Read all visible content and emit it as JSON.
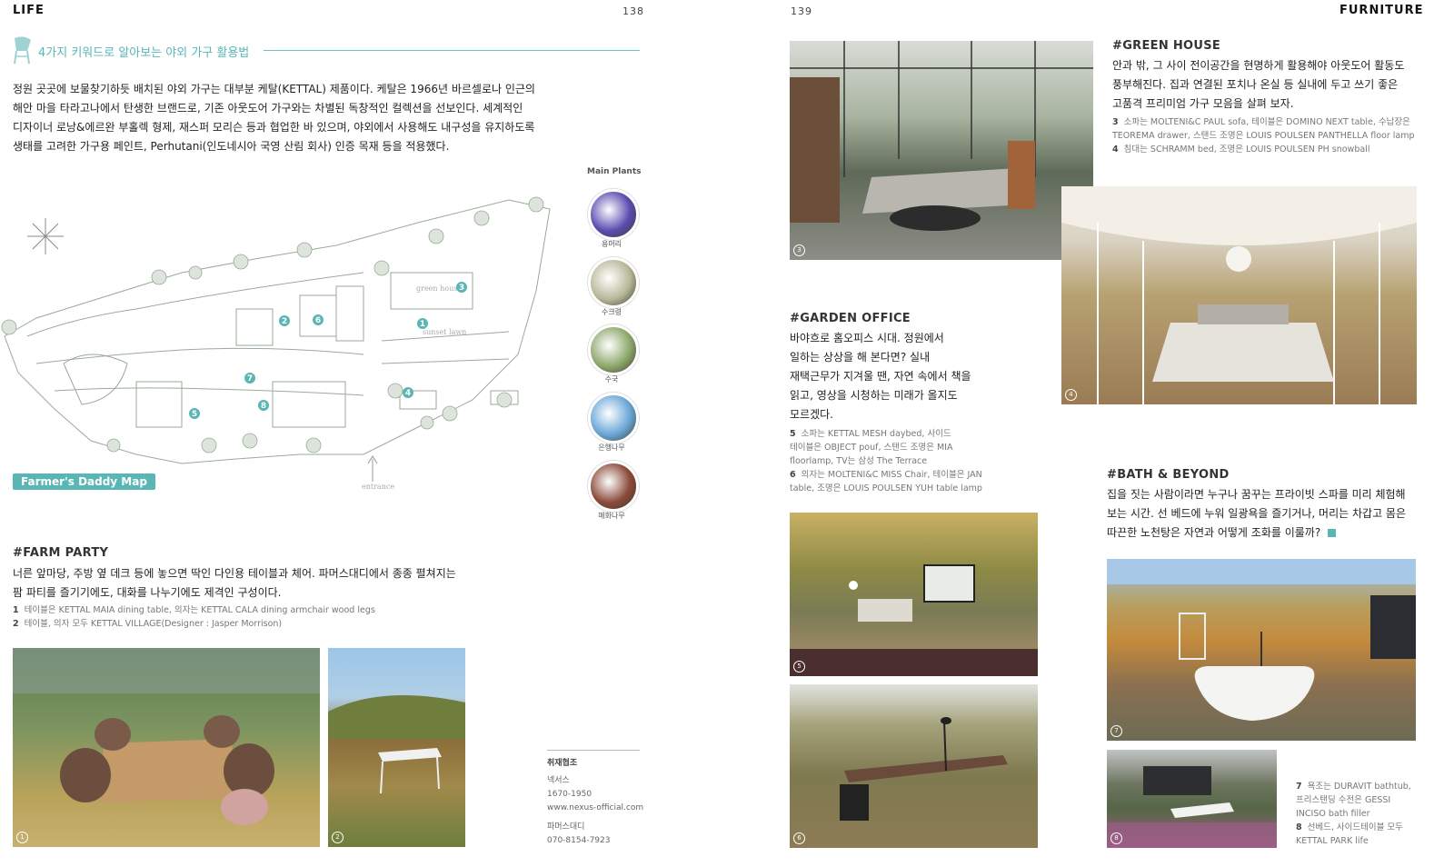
{
  "left_page": {
    "section": "LIFE",
    "page_number": "138",
    "heading": "4가지 키워드로 알아보는 야외 가구 활용법",
    "intro": [
      "정원 곳곳에 보물찾기하듯 배치된 야외 가구는 대부분 케탈(KETTAL) 제품이다. 케탈은 1966년 바르셀로나 인근의",
      "해안 마을 타라고나에서 탄생한 브랜드로, 기존 아웃도어 가구와는 차별된 독창적인 컬렉션을 선보인다. 세계적인",
      "디자이너 로낭&에르완 부홀렉 형제, 재스퍼 모리슨 등과 협업한 바 있으며, 야외에서 사용해도 내구성을 유지하도록",
      "생태를 고려한 가구용 페인트, Perhutani(인도네시아 국영 산림 회사) 인증 목재 등을 적용했다."
    ],
    "map_label": "Farmer's Daddy Map",
    "map_entrance": "entrance",
    "map_places": [
      "green house",
      "sunset lawn"
    ],
    "map_numbers": [
      "1",
      "2",
      "3",
      "4",
      "5",
      "6",
      "7",
      "8"
    ],
    "plants_title": "Main Plants",
    "plants": [
      {
        "name": "용머리",
        "color": "#5a4cb0"
      },
      {
        "name": "수크령",
        "color": "#b8b89a"
      },
      {
        "name": "수국",
        "color": "#8ea86c"
      },
      {
        "name": "은행나무",
        "color": "#6ba7d8"
      },
      {
        "name": "매화나무",
        "color": "#8b4a3a"
      }
    ],
    "farm_party": {
      "tag": "#FARM PARTY",
      "text": [
        "너른 앞마당, 주방 옆 데크 등에 놓으면 딱인 다인용 테이블과 체어. 파머스대디에서 종종 펼쳐지는",
        "팜 파티를 즐기기에도, 대화를 나누기에도 제격인 구성이다."
      ],
      "captions": [
        {
          "num": "1",
          "text": "테이블은 KETTAL MAIA dining table, 의자는 KETTAL CALA dining armchair wood legs"
        },
        {
          "num": "2",
          "text": "테이블, 의자 모두 KETTAL VILLAGE(Designer : Jasper Morrison)"
        }
      ]
    },
    "photos": [
      {
        "num": "1"
      },
      {
        "num": "2"
      }
    ],
    "credits": {
      "title": "취재협조",
      "lines_a": [
        "넥서스",
        "1670-1950",
        "www.nexus-official.com"
      ],
      "lines_b": [
        "파머스대디",
        "070-8154-7923"
      ]
    }
  },
  "right_page": {
    "section": "FURNITURE",
    "page_number": "139",
    "green_house": {
      "tag": "#GREEN HOUSE",
      "text": [
        "안과 밖, 그 사이 전이공간을 현명하게 활용해야 아웃도어 활동도",
        "풍부해진다. 집과 연결된 포치나 온실 등 실내에 두고 쓰기 좋은",
        "고품격 프리미엄 가구 모음을 살펴 보자."
      ],
      "captions": [
        {
          "num": "3",
          "text": "소파는 MOLTENI&C PAUL sofa, 테이블은 DOMINO NEXT table, 수납장은"
        },
        {
          "num": "",
          "text": "TEOREMA drawer, 스탠드 조명은 LOUIS POULSEN PANTHELLA floor lamp"
        },
        {
          "num": "4",
          "text": "침대는 SCHRAMM bed, 조명은 LOUIS POULSEN PH snowball"
        }
      ]
    },
    "garden_office": {
      "tag": "#GARDEN OFFICE",
      "text": [
        "바야흐로 홈오피스 시대. 정원에서",
        "일하는 상상을 해 본다면? 실내",
        "재택근무가 지겨울 땐, 자연 속에서 책을",
        "읽고, 영상을 시청하는 미래가 올지도",
        "모르겠다."
      ],
      "captions": [
        {
          "num": "5",
          "text": "소파는 KETTAL MESH daybed, 사이드"
        },
        {
          "num": "",
          "text": "테이블은 OBJECT pouf, 스탠드 조명은 MIA"
        },
        {
          "num": "",
          "text": "floorlamp, TV는 삼성 The Terrace"
        },
        {
          "num": "6",
          "text": "의자는 MOLTENI&C MISS Chair, 테이블은 JAN"
        },
        {
          "num": "",
          "text": "table, 조명은 LOUIS POULSEN YUH table lamp"
        }
      ]
    },
    "bath_beyond": {
      "tag": "#BATH & BEYOND",
      "text": [
        "집을 짓는 사람이라면 누구나 꿈꾸는 프라이빗 스파를 미리 체험해",
        "보는 시간. 선 베드에 누워 일광욕을 즐기거나, 머리는 차갑고 몸은",
        "따끈한 노천탕은 자연과 어떻게 조화를 이룰까?"
      ],
      "captions": [
        {
          "num": "7",
          "text": "욕조는 DURAVIT bathtub,"
        },
        {
          "num": "",
          "text": "프리스탠딩 수전은 GESSI"
        },
        {
          "num": "",
          "text": "INCISO bath filler"
        },
        {
          "num": "8",
          "text": "선베드, 사이드테이블 모두"
        },
        {
          "num": "",
          "text": "KETTAL PARK life"
        }
      ]
    },
    "photos": [
      {
        "num": "3"
      },
      {
        "num": "4"
      },
      {
        "num": "5"
      },
      {
        "num": "6"
      },
      {
        "num": "7"
      },
      {
        "num": "8"
      }
    ]
  }
}
